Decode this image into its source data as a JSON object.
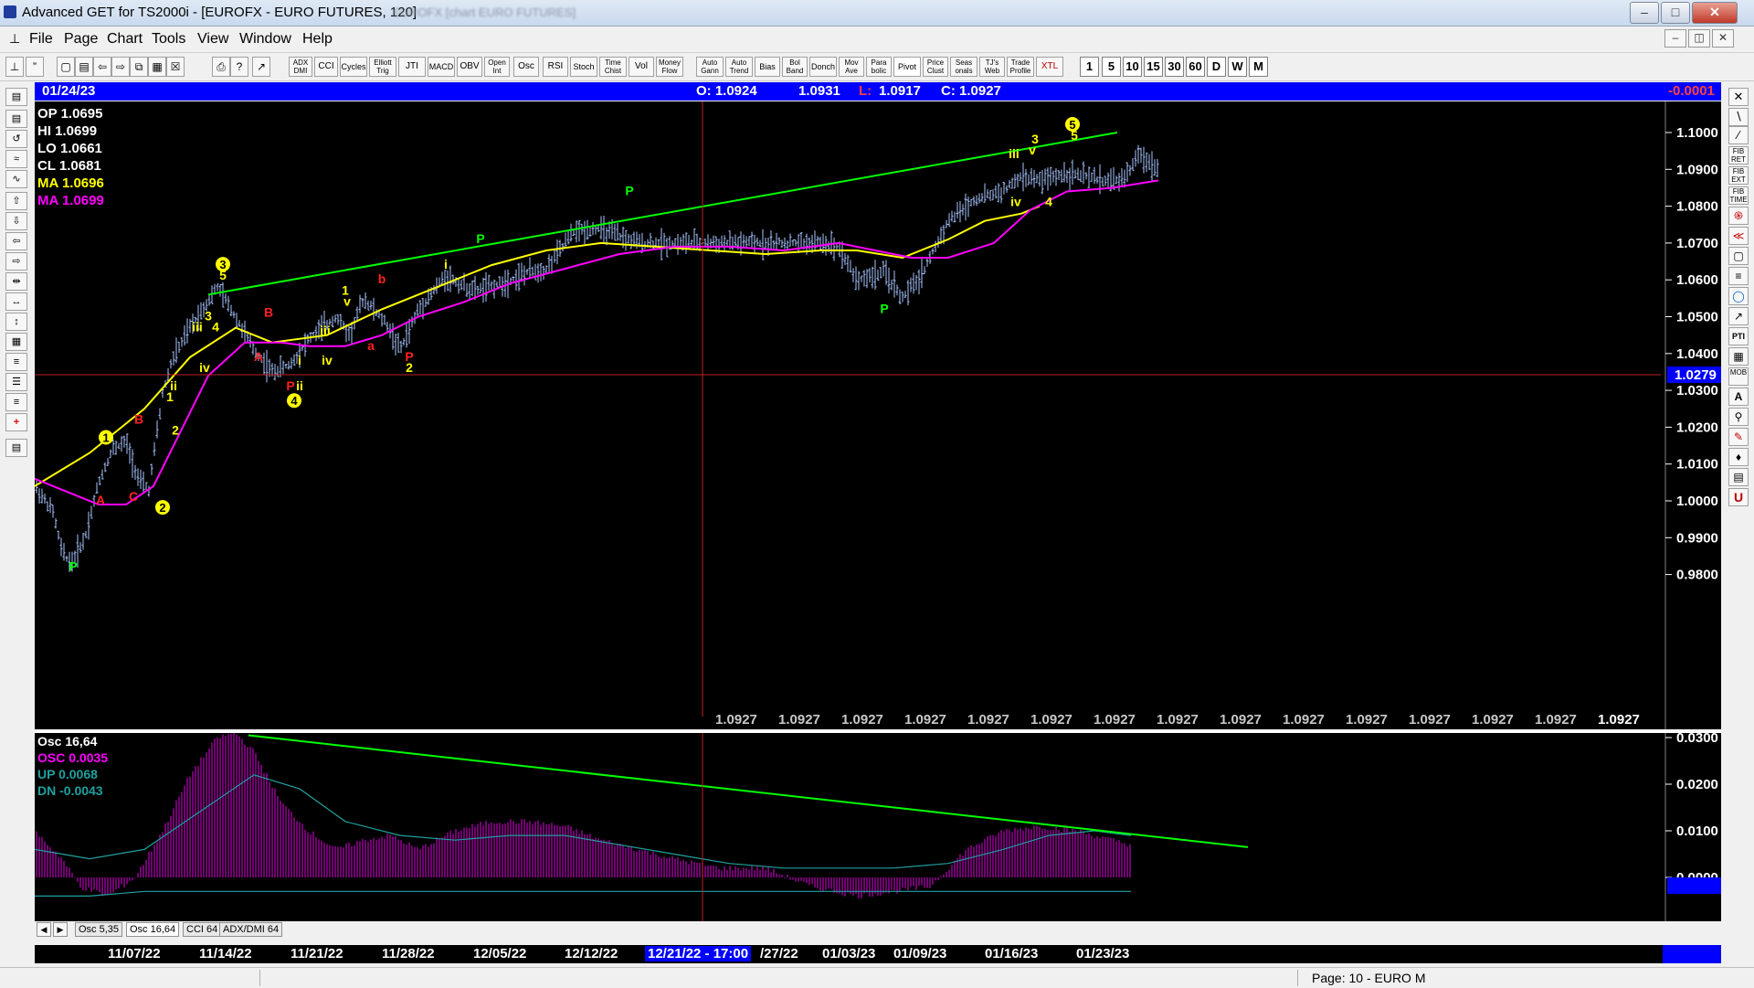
{
  "window": {
    "title": "Advanced GET for TS2000i - [EUROFX - EURO FUTURES, 120]",
    "blurred_title": "EUROFX [chart EURO FUTURES]"
  },
  "menu": [
    "File",
    "Page",
    "Chart",
    "Tools",
    "View",
    "Window",
    "Help"
  ],
  "toolbar": {
    "studies": [
      "ADX DMI",
      "CCI",
      "Cycles",
      "Elliott Trig",
      "JTI",
      "MACD",
      "OBV",
      "Open Int",
      "Osc",
      "RSI",
      "Stoch",
      "Time Chist",
      "Vol",
      "Money Flow",
      "Auto Gann",
      "Auto Trend",
      "Bias",
      "Bol Band",
      "Donch",
      "Mov Ave",
      "Para bolic",
      "Pivot",
      "Price Clust",
      "Seas onals",
      "TJ's Web",
      "Trade Profile",
      "XTL"
    ],
    "timeframes": [
      "1",
      "5",
      "10",
      "15",
      "30",
      "60",
      "D",
      "W",
      "M"
    ]
  },
  "info_bar": {
    "date": "01/24/23",
    "open": "O: 1.0924",
    "high": "1.0931",
    "low_label": "L:",
    "low": "1.0917",
    "close": "C: 1.0927",
    "change": "-0.0001"
  },
  "legend": {
    "op": "OP  1.0695",
    "hi": "HI   1.0699",
    "lo": "LO  1.0661",
    "cl": "CL  1.0681",
    "ma": "MA  1.0696",
    "ma2": "MA  1.0699"
  },
  "price_axis": {
    "ticks": [
      "1.1000",
      "1.0900",
      "1.0800",
      "1.0700",
      "1.0600",
      "1.0500",
      "1.0400",
      "1.0300",
      "1.0200",
      "1.0100",
      "1.0000",
      "0.9900",
      "0.9800"
    ],
    "cursor_price": "1.0279",
    "projection_value": "1.0927"
  },
  "osc_legend": {
    "title": "Osc 16,64",
    "osc": "OSC 0.0035",
    "up": "UP   0.0068",
    "dn": "DN   -0.0043"
  },
  "osc_axis": {
    "ticks": [
      "0.0300",
      "0.0200",
      "0.0100",
      "0.0000"
    ]
  },
  "osc_tabs": [
    "Osc 5,35",
    "Osc 16,64",
    "CCI 64",
    "ADX/DMI 64"
  ],
  "date_axis": [
    "11/07/22",
    "11/14/22",
    "11/21/22",
    "11/28/22",
    "12/05/22",
    "12/12/22",
    "12/21/22 - 17:00",
    "/27/22",
    "01/03/23",
    "01/09/23",
    "01/16/23",
    "01/23/23"
  ],
  "status": "Page: 10 - EURO M",
  "colors": {
    "up_bar": "#a8c4ff",
    "ma_fast": "#ffff00",
    "ma_slow": "#ff00ff",
    "trend": "#00ff00",
    "pivot_green": "#00ff00",
    "label_red": "#ff2020",
    "wave_yellow": "#ffff00"
  },
  "chart_data": {
    "type": "ohlc-with-elliott-waves",
    "instrument": "EUROFX - EURO FUTURES",
    "bar_interval": "120",
    "wave_labels": [
      {
        "text": "P",
        "price": 0.981
      },
      {
        "text": "1",
        "price": 1.016
      },
      {
        "text": "B",
        "price": 1.021
      },
      {
        "text": "A",
        "price": 0.999
      },
      {
        "text": "C",
        "price": 1.0
      },
      {
        "text": "2",
        "price": 0.997
      },
      {
        "text": "1",
        "price": 1.027
      },
      {
        "text": "ii",
        "price": 1.03
      },
      {
        "text": "2",
        "price": 1.018
      },
      {
        "text": "iii",
        "price": 1.046
      },
      {
        "text": "iv",
        "price": 1.035
      },
      {
        "text": "3",
        "price": 1.049
      },
      {
        "text": "4",
        "price": 1.046
      },
      {
        "text": "3",
        "price": 1.063
      },
      {
        "text": "5",
        "price": 1.06
      },
      {
        "text": "B",
        "price": 1.05
      },
      {
        "text": "A",
        "price": 1.038
      },
      {
        "text": "P",
        "price": 1.03
      },
      {
        "text": "i",
        "price": 1.037
      },
      {
        "text": "ii",
        "price": 1.03
      },
      {
        "text": "4",
        "price": 1.026
      },
      {
        "text": "iii",
        "price": 1.045
      },
      {
        "text": "iv",
        "price": 1.037
      },
      {
        "text": "1",
        "price": 1.056
      },
      {
        "text": "v",
        "price": 1.053
      },
      {
        "text": "b",
        "price": 1.059
      },
      {
        "text": "a",
        "price": 1.041
      },
      {
        "text": "P",
        "price": 1.038
      },
      {
        "text": "2",
        "price": 1.035
      },
      {
        "text": "i",
        "price": 1.063
      },
      {
        "text": "P",
        "price": 1.07
      },
      {
        "text": "P",
        "price": 1.083
      },
      {
        "text": "P",
        "price": 1.051
      },
      {
        "text": "iii",
        "price": 1.093
      },
      {
        "text": "iv",
        "price": 1.08
      },
      {
        "text": "3",
        "price": 1.097
      },
      {
        "text": "v",
        "price": 1.094
      },
      {
        "text": "4",
        "price": 1.08
      },
      {
        "text": "5",
        "price": 1.101
      },
      {
        "text": "5",
        "price": 1.098
      }
    ],
    "price_range": [
      0.977,
      1.1035
    ]
  }
}
